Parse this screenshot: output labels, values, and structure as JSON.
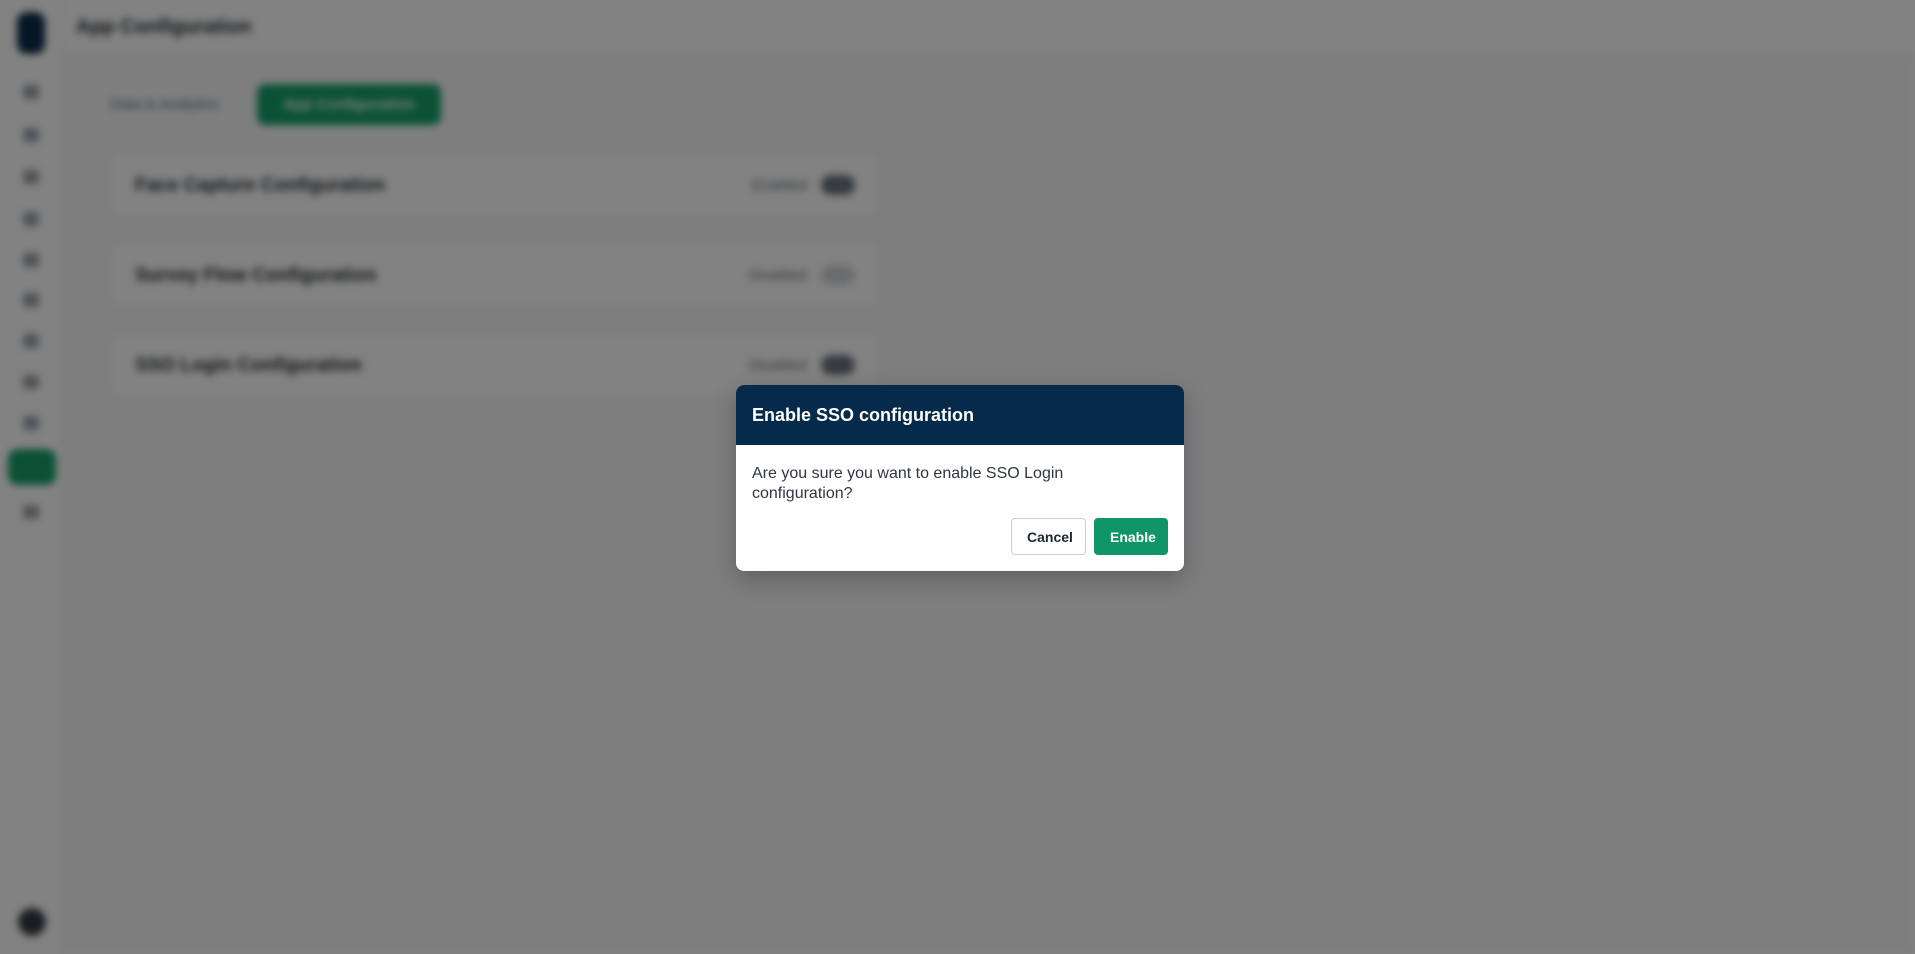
{
  "app": {
    "page_title": "App Configuration"
  },
  "sidebar": {
    "nav_icons": [
      "home-icon",
      "users-icon",
      "grid-icon",
      "chart-icon",
      "filter-icon",
      "list-icon",
      "message-icon",
      "bell-icon",
      "folder-icon",
      "settings-icon",
      "help-icon"
    ],
    "active_index": 9,
    "accent_color": "#15a06a"
  },
  "tabs": [
    {
      "label": "Data & Analytics",
      "active": false
    },
    {
      "label": "App Configuration",
      "active": true
    }
  ],
  "configurations": [
    {
      "title": "Face Capture Configuration",
      "status": "Enabled",
      "enabled": true
    },
    {
      "title": "Survey Flow Configuration",
      "status": "Disabled",
      "enabled": false
    },
    {
      "title": "SSO Login Configuration",
      "status": "Disabled",
      "enabled": true
    }
  ],
  "modal": {
    "title": "Enable SSO configuration",
    "message": "Are you sure you want to enable SSO Login configuration?",
    "cancel_label": "Cancel",
    "confirm_label": "Enable",
    "header_color": "#062b4a",
    "confirm_color": "#0f9568"
  }
}
